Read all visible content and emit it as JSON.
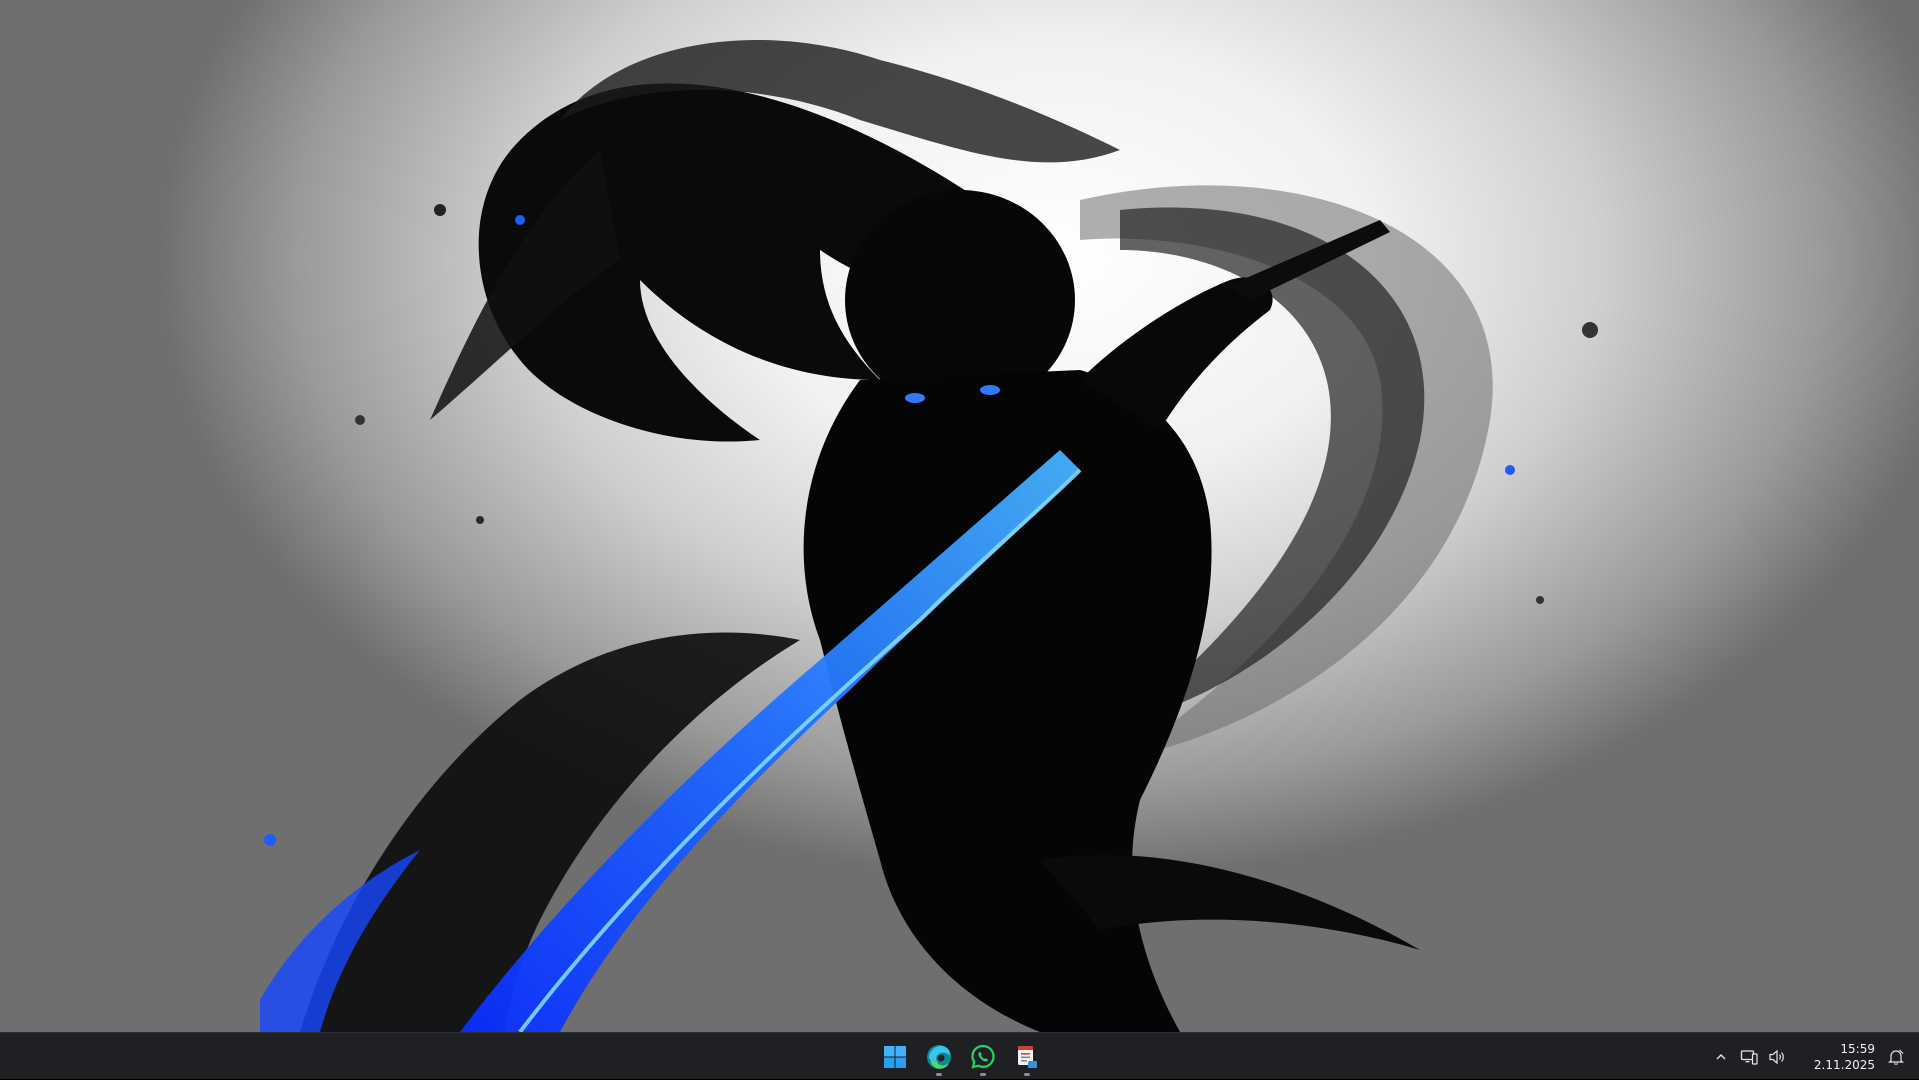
{
  "wallpaper": {
    "accent_blue": "#1f5cff",
    "ink": "#050505"
  },
  "taskbar": {
    "background": "#1f2024",
    "pinned": [
      {
        "name": "start-button",
        "icon": "windows-logo-icon"
      },
      {
        "name": "edge-button",
        "icon": "edge-icon"
      },
      {
        "name": "whatsapp-button",
        "icon": "whatsapp-icon"
      },
      {
        "name": "app-button",
        "icon": "app-document-icon"
      }
    ],
    "tray": {
      "show_hidden_icon": "chevron-up-icon",
      "network_icon": "network-icon",
      "volume_icon": "speaker-icon",
      "time": "15:59",
      "date": "2.11.2025",
      "notification_icon": "notification-bell-icon"
    }
  }
}
